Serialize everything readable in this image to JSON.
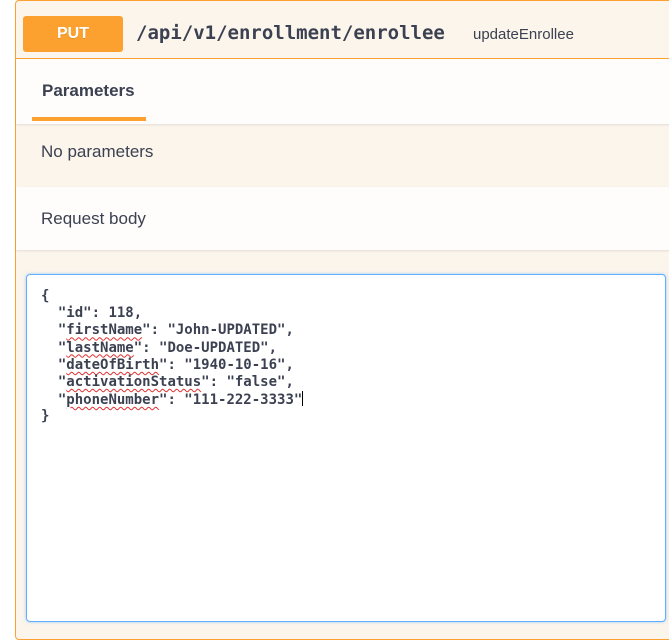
{
  "operation": {
    "method": "PUT",
    "path": "/api/v1/enrollment/enrollee",
    "operation_id": "updateEnrollee"
  },
  "tabs": [
    {
      "label": "Parameters",
      "active": true
    }
  ],
  "parameters": {
    "empty_text": "No parameters"
  },
  "request_body": {
    "title": "Request body",
    "lines": [
      {
        "indent": "",
        "pre": "{",
        "key": "",
        "post": ""
      },
      {
        "indent": "  ",
        "pre": "\"",
        "key": "id",
        "post": "\": 118,"
      },
      {
        "indent": "  ",
        "pre": "\"",
        "key": "firstName",
        "post": "\": \"John-UPDATED\","
      },
      {
        "indent": "  ",
        "pre": "\"",
        "key": "lastName",
        "post": "\": \"Doe-UPDATED\","
      },
      {
        "indent": "  ",
        "pre": "\"",
        "key": "dateOfBirth",
        "post": "\": \"1940-10-16\","
      },
      {
        "indent": "  ",
        "pre": "\"",
        "key": "activationStatus",
        "post": "\": \"false\","
      },
      {
        "indent": "  ",
        "pre": "\"",
        "key": "phoneNumber",
        "post": "\": \"111-222-3333\""
      },
      {
        "indent": "",
        "pre": "}",
        "key": "",
        "post": ""
      }
    ],
    "spellcheck_flagged_keys": [
      "firstName",
      "lastName",
      "dateOfBirth",
      "activationStatus",
      "phoneNumber"
    ]
  },
  "colors": {
    "put_accent": "#fca130",
    "put_background": "#fcf5ec",
    "text": "#3b4151",
    "editor_focus_border": "#61affe",
    "spellcheck_squiggle": "#e03030"
  }
}
